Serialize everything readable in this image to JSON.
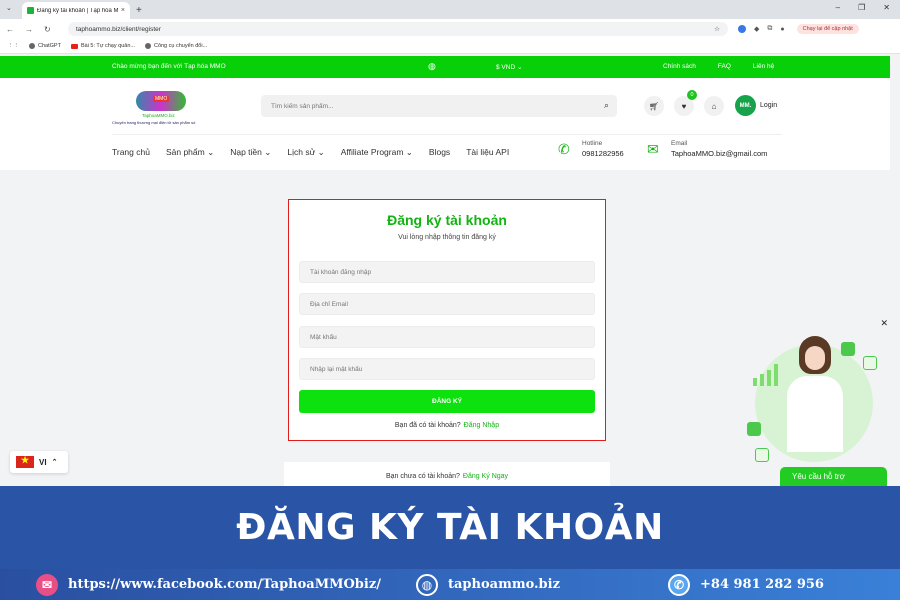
{
  "browser": {
    "tab_title": "Đăng ký tài khoản | Tạp hóa M...",
    "url": "taphoammo.biz/client/register",
    "resume_label": "Chạy lại để cập nhật",
    "bookmarks": [
      "ChatGPT",
      "Bài 5: Tự chạy quản...",
      "Công cụ chuyển đổi..."
    ]
  },
  "topbar": {
    "welcome": "Chào mừng bạn đến với Tạp hóa MMO",
    "currency": "VND",
    "links": [
      "Chính sách",
      "FAQ",
      "Liên hệ"
    ]
  },
  "header": {
    "logo_name": "TaphoaMMO.biz",
    "logo_slogan": "Chuyên trang thương mại điện tử sản phẩm số",
    "search_placeholder": "Tìm kiếm sản phẩm...",
    "wishlist_count": "0",
    "avatar_initials": "MM.",
    "login_label": "Login",
    "nav": [
      "Trang chủ",
      "Sản phẩm",
      "Nạp tiền",
      "Lịch sử",
      "Affiliate Program",
      "Blogs",
      "Tài liệu API"
    ],
    "hotline_label": "Hotline",
    "hotline_value": "0981282956",
    "email_label": "Email",
    "email_value": "TaphoaMMO.biz@gmail.com"
  },
  "register": {
    "title": "Đăng ký tài khoản",
    "subtitle": "Vui lòng nhập thông tin đăng ký",
    "username_placeholder": "Tài khoản đăng nhập",
    "email_placeholder": "Địa chỉ Email",
    "password_placeholder": "Mật khẩu",
    "confirm_placeholder": "Nhập lại mật khẩu",
    "submit_label": "ĐĂNG KÝ",
    "have_account": "Bạn đã có tài khoản?",
    "login_link": "Đăng Nhập"
  },
  "alt_card": {
    "no_account": "Bạn chưa có tài khoản?",
    "signup_link": "Đăng Ký Ngay"
  },
  "language": {
    "code": "VI"
  },
  "support": {
    "label": "Yêu cầu hỗ trợ"
  },
  "banner": {
    "title": "ĐĂNG KÝ TÀI KHOẢN"
  },
  "footer": {
    "facebook": "https://www.facebook.com/TaphoaMMObiz/",
    "website": "taphoammo.biz",
    "phone": "+84 981 282 956"
  },
  "colors": {
    "brand_green": "#08d008",
    "accent_red": "#e31b1b",
    "banner_blue": "#2a55a6"
  }
}
